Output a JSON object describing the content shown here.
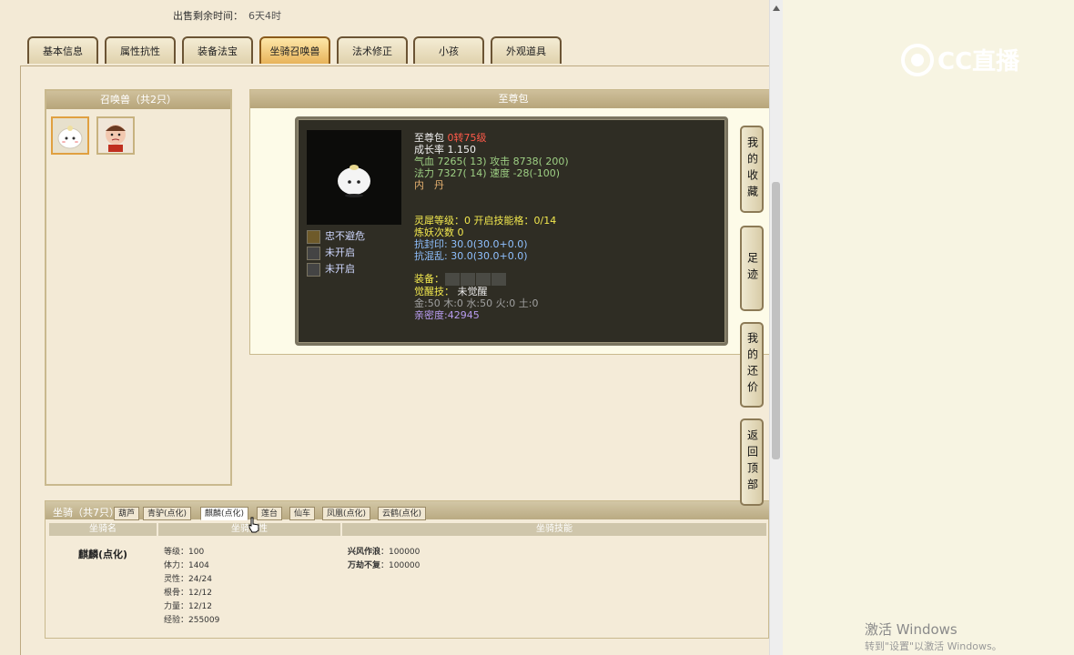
{
  "sale": {
    "label": "出售剩余时间：",
    "value": "6天4时"
  },
  "tabs": [
    "基本信息",
    "属性抗性",
    "装备法宝",
    "坐骑召唤兽",
    "法术修正",
    "小孩",
    "外观道具"
  ],
  "summons_panel": {
    "title": "召唤兽（共2只）"
  },
  "detail_panel": {
    "title": "至尊包"
  },
  "pet": {
    "name": "至尊包",
    "level": "0转75级",
    "growth_label": "成长率",
    "growth": "1.150",
    "hp_label": "气血",
    "hp": "7265( 13)",
    "attack_label": "攻击",
    "attack": "8738( 200)",
    "mp_label": "法力",
    "mp": "7327( 14)",
    "speed_label": "速度",
    "speed": "-28(-100)",
    "neidan": "内　丹",
    "lingxi": "灵犀等级：0 开启技能格：0/14",
    "lianyao": "炼妖次数 0",
    "kangfengyin": "抗封印: 30.0(30.0+0.0)",
    "kanghunluan": "抗混乱: 30.0(30.0+0.0)",
    "equip_label": "装备：",
    "awaken_label": "觉醒技：",
    "awaken_value": "未觉醒",
    "elements": "金:50 木:0 水:50 火:0 土:0",
    "intimacy": "亲密度:42945"
  },
  "pet_skills": [
    "忠不避危",
    "未开启",
    "未开启"
  ],
  "side_buttons": [
    "我的收藏",
    "足迹",
    "我的还价",
    "返回顶部"
  ],
  "mount": {
    "title": "坐骑（共7只）",
    "tabs": [
      "葫芦",
      "青驴(点化)",
      "麒麟(点化)",
      "莲台",
      "仙车",
      "凤凰(点化)",
      "云鹤(点化)"
    ],
    "columns": [
      "坐骑名",
      "坐骑属性",
      "坐骑技能"
    ],
    "name": "麒麟(点化)",
    "stats": [
      "等级：100",
      "体力：1404",
      "灵性：24/24",
      "根骨：12/12",
      "力量：12/12",
      "经验：255009"
    ],
    "skills": [
      {
        "name": "兴风作浪",
        "value": "：100000"
      },
      {
        "name": "万劫不复",
        "value": "：100000"
      }
    ]
  },
  "watermark": "CC直播",
  "activate": {
    "title": "激活 Windows",
    "sub": "转到\"设置\"以激活 Windows。"
  }
}
